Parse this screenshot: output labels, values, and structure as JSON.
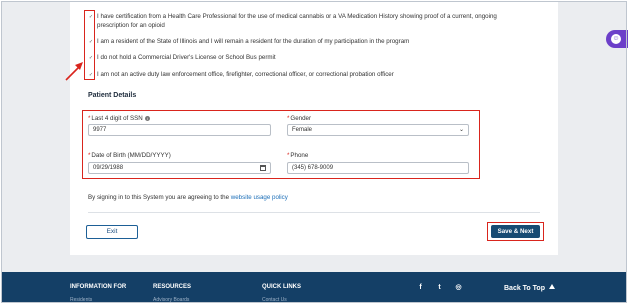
{
  "certifications": [
    {
      "line1": "I have certification from a Health Care Professional for the use of medical cannabis or a VA Medication History showing proof of a current, ongoing",
      "line2": "prescription for an opioid",
      "checked": true
    },
    {
      "line1": "I am a resident of the State of Illinois and I will remain a resident for the duration of my participation in the program",
      "checked": true
    },
    {
      "line1": "I do not hold a Commercial Driver's License or School Bus permit",
      "checked": true
    },
    {
      "line1": "I am not an active duty law enforcement office, firefighter, correctional officer, or correctional probation officer",
      "checked": true
    }
  ],
  "patient": {
    "section_title": "Patient Details",
    "ssn": {
      "label": "Last 4 digit of SSN",
      "value": "9977",
      "info_icon": "i"
    },
    "gender": {
      "label": "Gender",
      "value": "Female"
    },
    "dob": {
      "label": "Date of Birth (MM/DD/YYYY)",
      "value": "09/29/1988"
    },
    "phone": {
      "label": "Phone",
      "value": "(345) 678-9009"
    },
    "required_mark": "*"
  },
  "agreement": {
    "text": "By signing in to this System you are agreeing to the ",
    "link": "website usage policy"
  },
  "buttons": {
    "exit": "Exit",
    "save": "Save & Next"
  },
  "footer": {
    "info": "INFORMATION FOR",
    "info_sub": "Residents",
    "resources": "RESOURCES",
    "resources_sub": "Advisory Boards",
    "quick": "QUICK LINKS",
    "quick_sub": "Contact Us",
    "back_top": "Back To Top",
    "social": {
      "facebook": "f",
      "twitter": "t",
      "instagram": "◎"
    }
  },
  "icons": {
    "checkmark": "✓",
    "chevron_down": "⌄",
    "accessibility": "☺"
  },
  "colors": {
    "primary": "#174b73",
    "footer": "#143f66",
    "highlight": "#d9251d",
    "link": "#1d6fb8",
    "accessibility": "#6c3fc9"
  }
}
